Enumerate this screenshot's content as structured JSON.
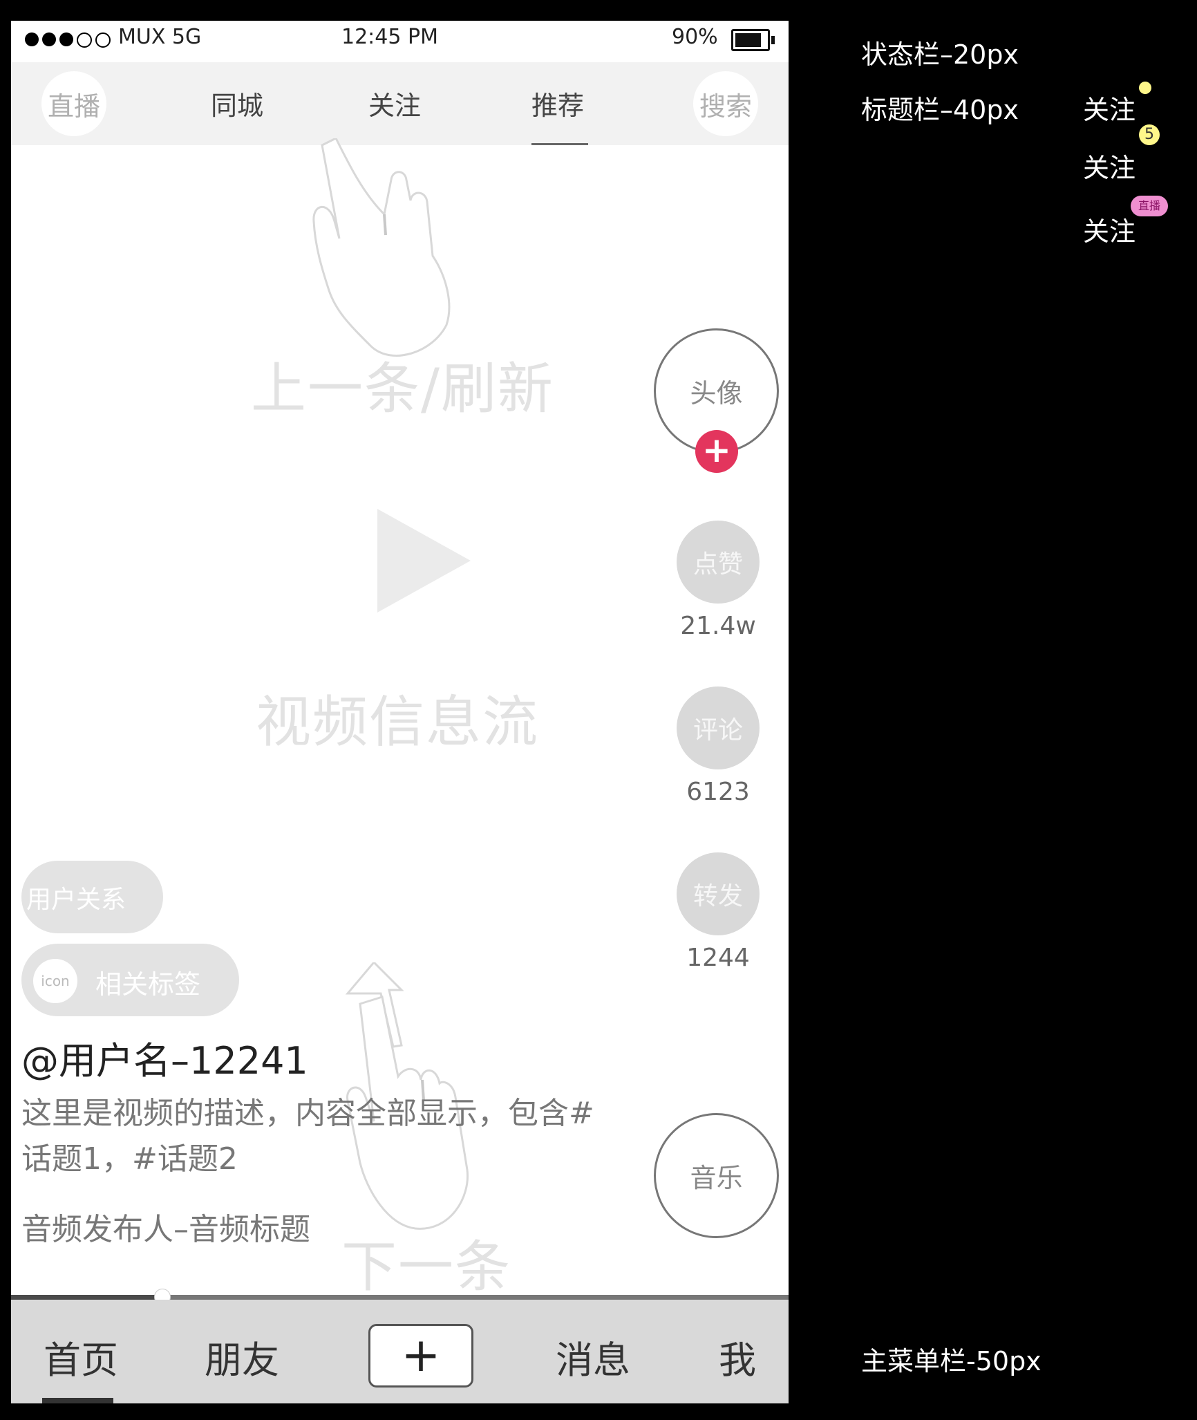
{
  "status_bar": {
    "carrier": "MUX 5G",
    "time": "12:45 PM",
    "battery_percent": "90%",
    "battery_level": 0.85,
    "signal_bars_filled": 3,
    "signal_bars_total": 5
  },
  "title_bar": {
    "live": "直播",
    "nearby": "同城",
    "following": "关注",
    "recommend": "推荐",
    "search": "搜索",
    "selected": "推荐"
  },
  "feed": {
    "refresh_hint": "上一条/刷新",
    "feed_label": "视频信息流",
    "next_hint": "下一条"
  },
  "actions": {
    "avatar": "头像",
    "like": "点赞",
    "like_count": "21.4w",
    "comment": "评论",
    "comment_count": "6123",
    "share": "转发",
    "share_count": "1244",
    "music": "音乐"
  },
  "info": {
    "user_relation": "用户关系",
    "tag_icon": "icon",
    "tag_label": "相关标签",
    "username": "@用户名–12241",
    "description": "这里是视频的描述，内容全部显示，包含#话题1，#话题2",
    "audio": "音频发布人–音频标题"
  },
  "progress": 0.195,
  "menu": {
    "home": "首页",
    "friends": "朋友",
    "add": "+",
    "messages": "消息",
    "me": "我",
    "selected": "首页"
  },
  "annotations": {
    "status_bar": "状态栏–20px",
    "title_bar": "标题栏–40px",
    "follow_1": "关注",
    "follow_2": "关注",
    "follow_2_badge": "5",
    "follow_3": "关注",
    "follow_3_badge": "直播",
    "menu_bar": "主菜单栏-50px"
  },
  "colors": {
    "follow_plus": "#e3355d",
    "badge_yellow": "#fff78a",
    "badge_live": "#ef8fd0"
  }
}
